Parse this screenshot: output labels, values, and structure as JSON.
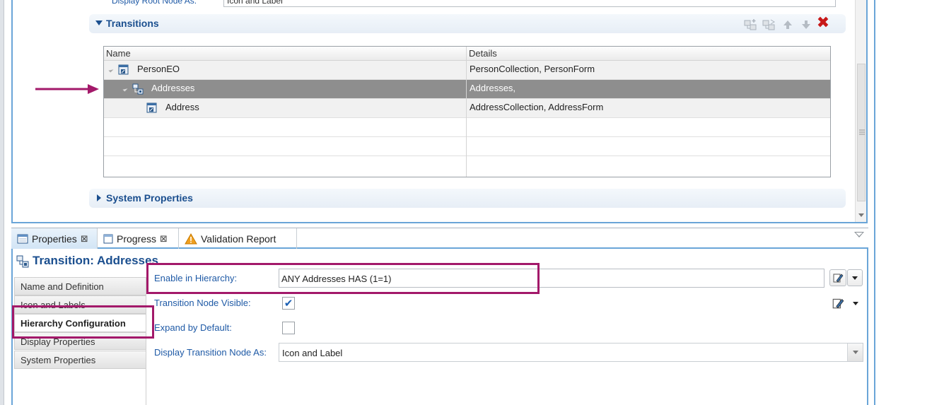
{
  "editor": {
    "prev_row": {
      "label": "Display Root Node As:",
      "value": "Icon and Label"
    },
    "transitions_section": {
      "title": "Transitions"
    },
    "system_section": {
      "title": "System Properties"
    },
    "table": {
      "columns": [
        "Name",
        "Details"
      ],
      "rows": [
        {
          "name": "PersonEO",
          "details": "PersonCollection, PersonForm",
          "indent": 0
        },
        {
          "name": "Addresses",
          "details": "Addresses,",
          "indent": 1,
          "selected": true
        },
        {
          "name": "Address",
          "details": "AddressCollection, AddressForm",
          "indent": 2
        }
      ]
    },
    "toolbar_icons": [
      "add-transition-icon",
      "add-child-transition-icon",
      "move-up-icon",
      "move-down-icon",
      "delete-icon"
    ],
    "delete_symbol": "✖"
  },
  "tabs": [
    {
      "label": "Properties",
      "close": "⊠",
      "icon": "properties-icon",
      "active": true
    },
    {
      "label": "Progress",
      "close": "⊠",
      "icon": "progress-icon"
    },
    {
      "label": "Validation Report",
      "icon": "warning-icon"
    }
  ],
  "properties": {
    "title": "Transition: Addresses",
    "side_tabs": [
      "Name and Definition",
      "Icon and Labels",
      "Hierarchy Configuration",
      "Display Properties",
      "System Properties"
    ],
    "active_side_tab": "Hierarchy Configuration",
    "fields": {
      "enable_hierarchy_label": "Enable in Hierarchy:",
      "enable_hierarchy_value": "ANY Addresses HAS (1=1)",
      "node_visible_label": "Transition Node Visible:",
      "node_visible_checked": true,
      "check_mark": "✔",
      "expand_default_label": "Expand by Default:",
      "expand_default_checked": false,
      "display_node_label": "Display Transition Node As:",
      "display_node_value": "Icon and Label"
    }
  },
  "colors": {
    "accent": "#1b4f8f",
    "highlight": "#a3196a",
    "selected_row": "#8e8e8e",
    "pane_border": "#6aa5d8"
  }
}
